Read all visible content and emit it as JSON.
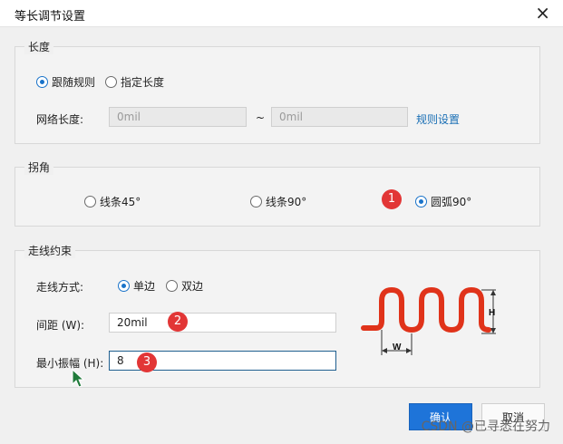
{
  "window": {
    "title": "等长调节设置",
    "close_glyph": "×"
  },
  "length_group": {
    "title": "长度",
    "options": [
      "跟随规则",
      "指定长度"
    ],
    "selected": "跟随规则",
    "net_length_label": "网络长度:",
    "min_value": "0mil",
    "separator": "~",
    "max_value": "0mil",
    "rule_link": "规则设置"
  },
  "corner_group": {
    "title": "拐角",
    "options": [
      "线条45°",
      "线条90°",
      "圆弧90°"
    ],
    "selected": "圆弧90°"
  },
  "routing_group": {
    "title": "走线约束",
    "mode_label": "走线方式:",
    "mode_options": [
      "单边",
      "双边"
    ],
    "mode_selected": "单边",
    "spacing_label": "间距 (W):",
    "spacing_value": "20mil",
    "amplitude_label": "最小振幅 (H):",
    "amplitude_value": "8",
    "diagram_labels": {
      "width": "W",
      "height": "H"
    }
  },
  "annotations": [
    "1",
    "2",
    "3"
  ],
  "buttons": {
    "ok": "确认",
    "cancel": "取消"
  },
  "watermark": "CSDN @已寻悉在努力",
  "colors": {
    "accent": "#1e74d9",
    "badge": "#e23636",
    "trace": "#e0331a"
  }
}
